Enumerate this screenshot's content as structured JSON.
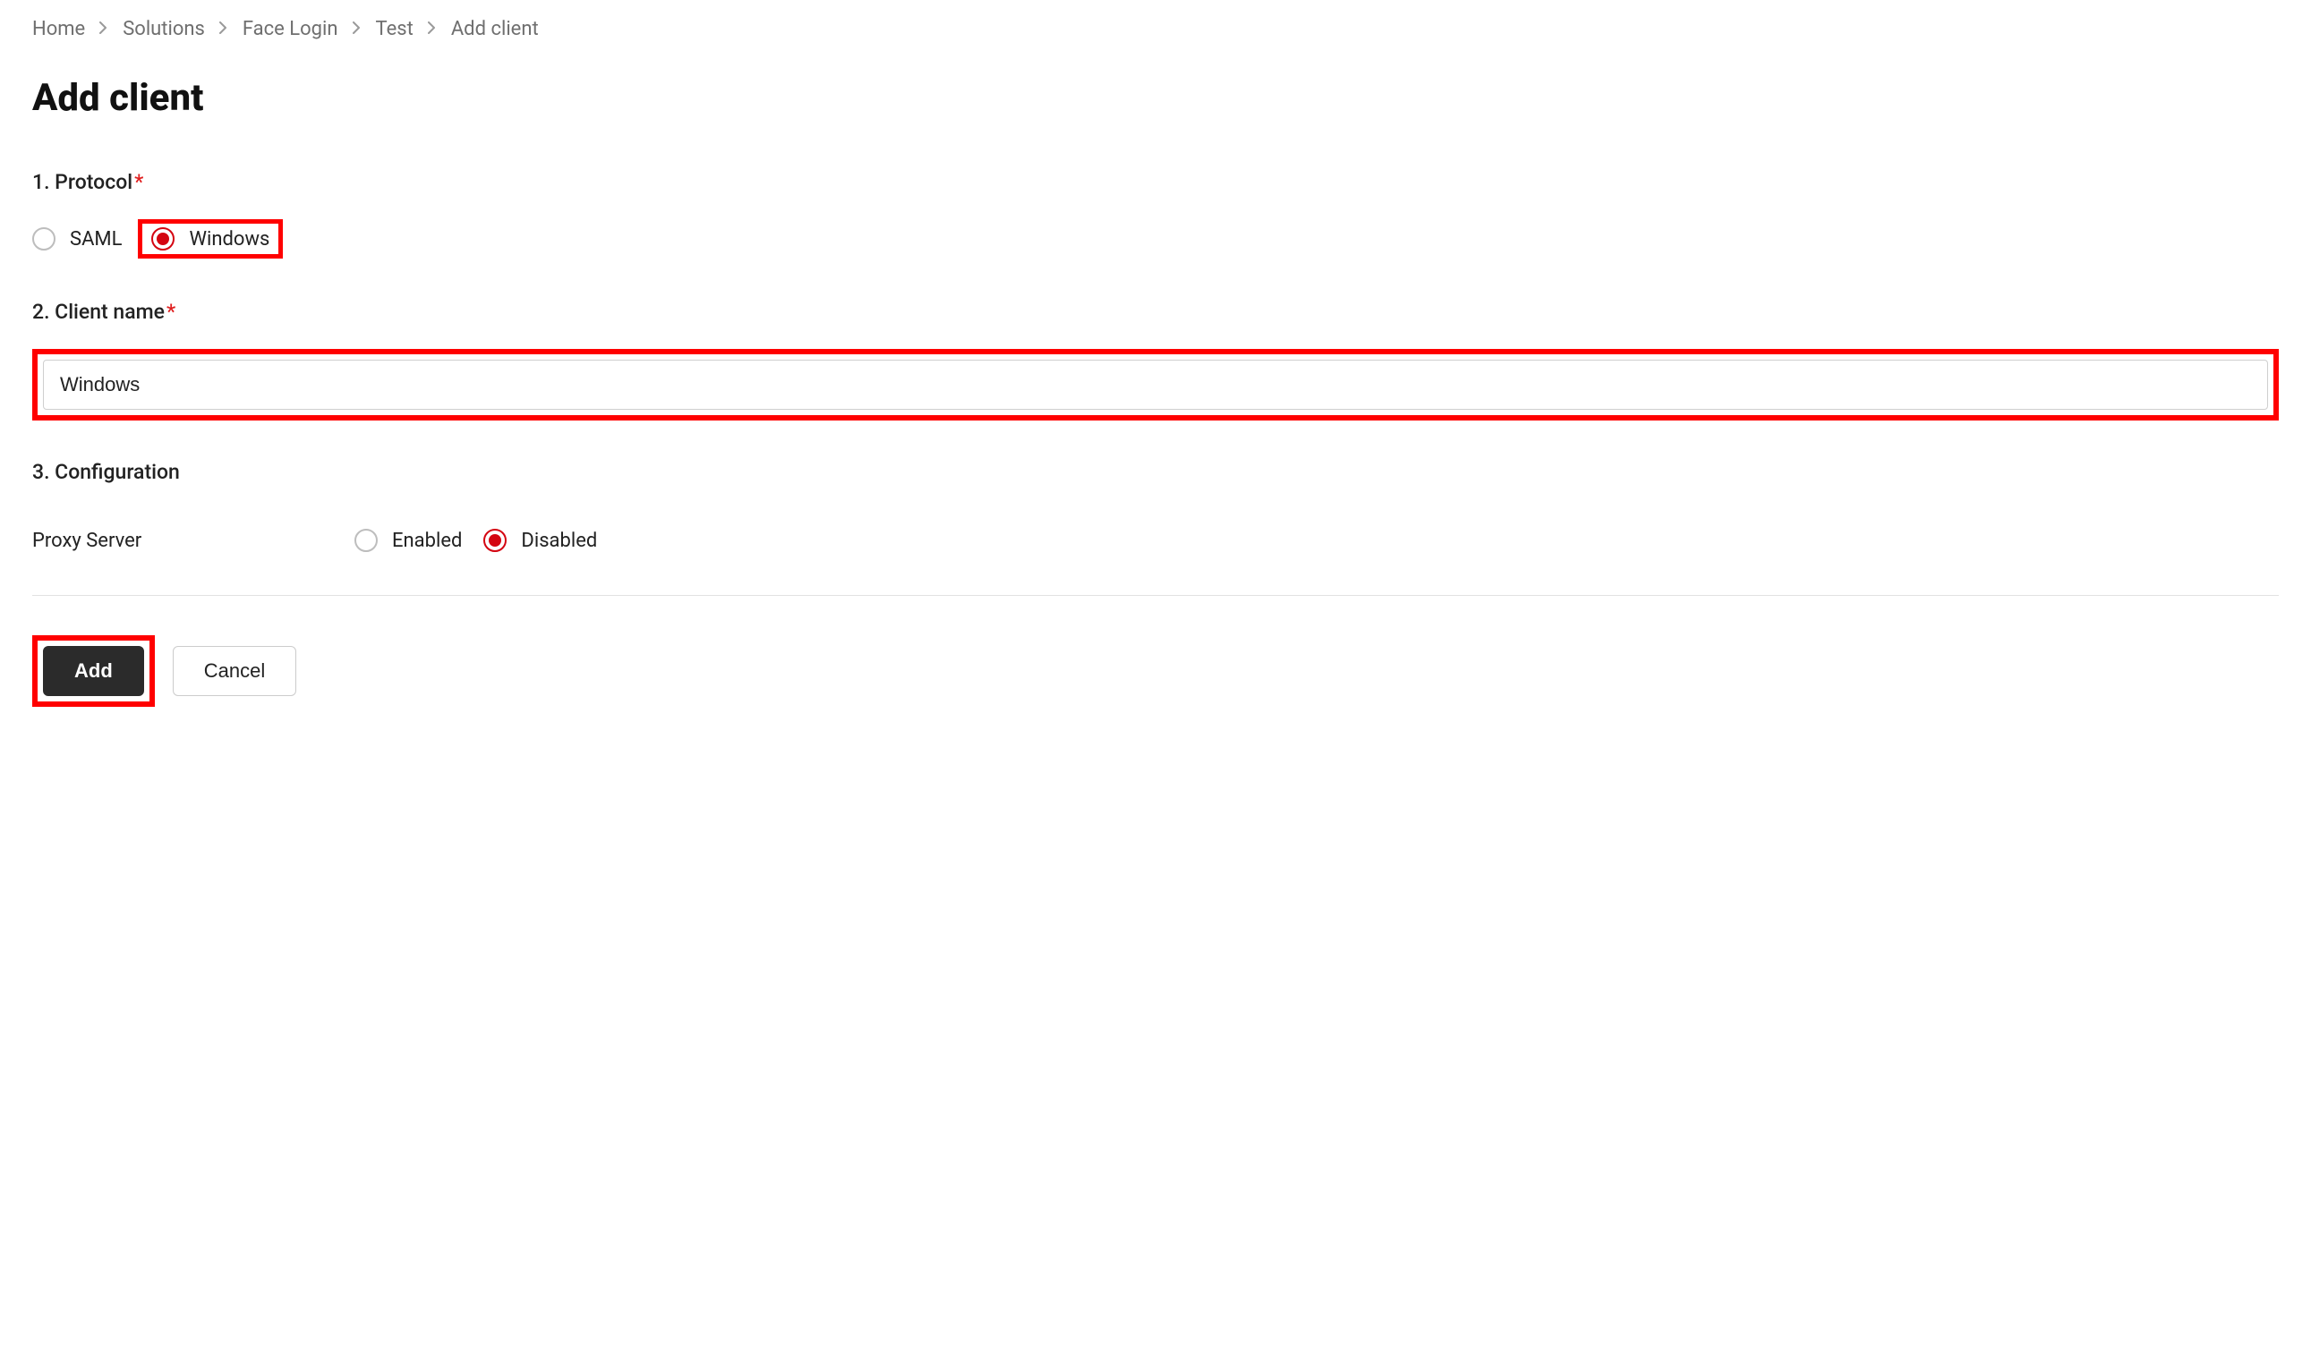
{
  "breadcrumb": {
    "items": [
      "Home",
      "Solutions",
      "Face Login",
      "Test"
    ],
    "current": "Add client"
  },
  "page": {
    "title": "Add client"
  },
  "form": {
    "protocol": {
      "label": "1. Protocol",
      "required": "*",
      "options": [
        {
          "value": "SAML",
          "selected": false
        },
        {
          "value": "Windows",
          "selected": true
        }
      ]
    },
    "clientName": {
      "label": "2. Client name",
      "required": "*",
      "value": "Windows"
    },
    "configuration": {
      "label": "3. Configuration",
      "proxy": {
        "label": "Proxy Server",
        "options": [
          {
            "value": "Enabled",
            "selected": false
          },
          {
            "value": "Disabled",
            "selected": true
          }
        ]
      }
    },
    "buttons": {
      "add": "Add",
      "cancel": "Cancel"
    }
  }
}
